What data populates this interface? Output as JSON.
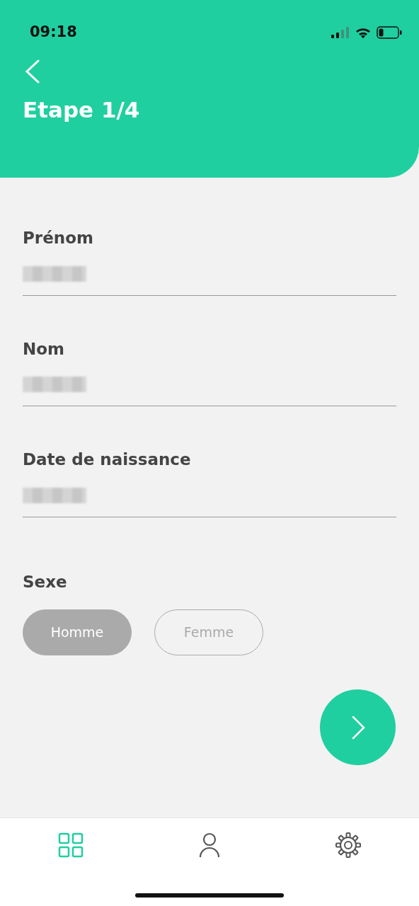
{
  "status_bar": {
    "time": "09:18"
  },
  "header": {
    "title": "Etape 1/4"
  },
  "fields": [
    {
      "label": "Prénom",
      "redacted": true
    },
    {
      "label": "Nom",
      "redacted": true
    },
    {
      "label": "Date de naissance",
      "redacted": true
    }
  ],
  "sex": {
    "label": "Sexe",
    "options": [
      {
        "label": "Homme",
        "selected": true
      },
      {
        "label": "Femme",
        "selected": false
      }
    ]
  },
  "tab_bar": {
    "items": [
      {
        "kind": "grid",
        "selected": true
      },
      {
        "kind": "person",
        "selected": false
      },
      {
        "kind": "gear",
        "selected": false
      }
    ]
  }
}
